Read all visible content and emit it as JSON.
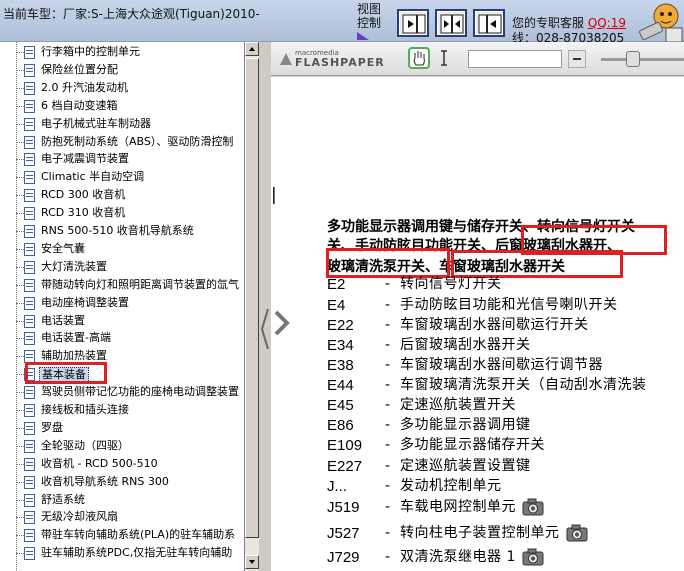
{
  "header": {
    "car_model": "当前车型：厂家:S-上海大众途观(Tiguan)2010-",
    "view_control": "视图控制",
    "service_label": "您的专职客服 ",
    "qq_label": "QQ:19",
    "phone": "线：028-87038205"
  },
  "tree": {
    "items": [
      "行李箱中的控制单元",
      "保险丝位置分配",
      "2.0 升汽油发动机",
      "6 档自动变速箱",
      "电子机械式驻车制动器",
      "防抱死制动系统（ABS）、驱动防滑控制",
      "电子减震调节装置",
      "Climatic 半自动空调",
      "RCD 300 收音机",
      "RCD 310 收音机",
      "RNS 500-510 收音机导航系统",
      "安全气囊",
      "大灯清洗装置",
      "带随动转向灯和照明距离调节装置的氙气",
      "电动座椅调整装置",
      "电话装置",
      "电话装置-高端",
      "辅助加热装置",
      "基本装备",
      "驾驶员侧带记忆功能的座椅电动调整装置",
      "接线板和插头连接",
      "罗盘",
      "全轮驱动（四驱）",
      "收音机 - RCD 500-510",
      "收音机导航系统 RNS 300",
      "舒适系统",
      "无级冷却液风扇",
      "带驻车转向辅助系统(PLA)的驻车辅助系",
      "驻车辅助系统PDC,仅指无驻车转向辅助"
    ],
    "selected_index": 18
  },
  "viewer": {
    "logo_small": "macromedia",
    "logo": "FLASHPAPER",
    "page_fragment": "|",
    "heading_lines": [
      "多功能显示器调用键与储存开关、转向信号灯开关",
      "关、手动防眩目功能开关、后窗玻璃刮水器开、",
      "玻璃清洗泵开关、车窗玻璃刮水器开关"
    ],
    "rows": [
      {
        "code": "E2",
        "desc": "转向信号灯开关",
        "camera": false
      },
      {
        "code": "E4",
        "desc": "手动防眩目功能和光信号喇叭开关",
        "camera": false
      },
      {
        "code": "E22",
        "desc": "车窗玻璃刮水器间歇运行开关",
        "camera": false
      },
      {
        "code": "E34",
        "desc": "后窗玻璃刮水器开关",
        "camera": false
      },
      {
        "code": "E38",
        "desc": "车窗玻璃刮水器间歇运行调节器",
        "camera": false
      },
      {
        "code": "E44",
        "desc": "车窗玻璃清洗泵开关（自动刮水清洗装",
        "camera": false
      },
      {
        "code": "E45",
        "desc": "定速巡航装置开关",
        "camera": false
      },
      {
        "code": "E86",
        "desc": "多功能显示器调用键",
        "camera": false
      },
      {
        "code": "E109",
        "desc": "多功能显示器储存开关",
        "camera": false
      },
      {
        "code": "E227",
        "desc": "定速巡航装置设置键",
        "camera": false
      },
      {
        "code": "J...",
        "desc": "发动机控制单元",
        "camera": false
      },
      {
        "code": "J519",
        "desc": "车载电网控制单元",
        "camera": true
      },
      {
        "code": "J527",
        "desc": "转向柱电子装置控制单元",
        "camera": true
      },
      {
        "code": "J729",
        "desc": "双清洗泵继电器 1",
        "camera": true
      }
    ]
  }
}
